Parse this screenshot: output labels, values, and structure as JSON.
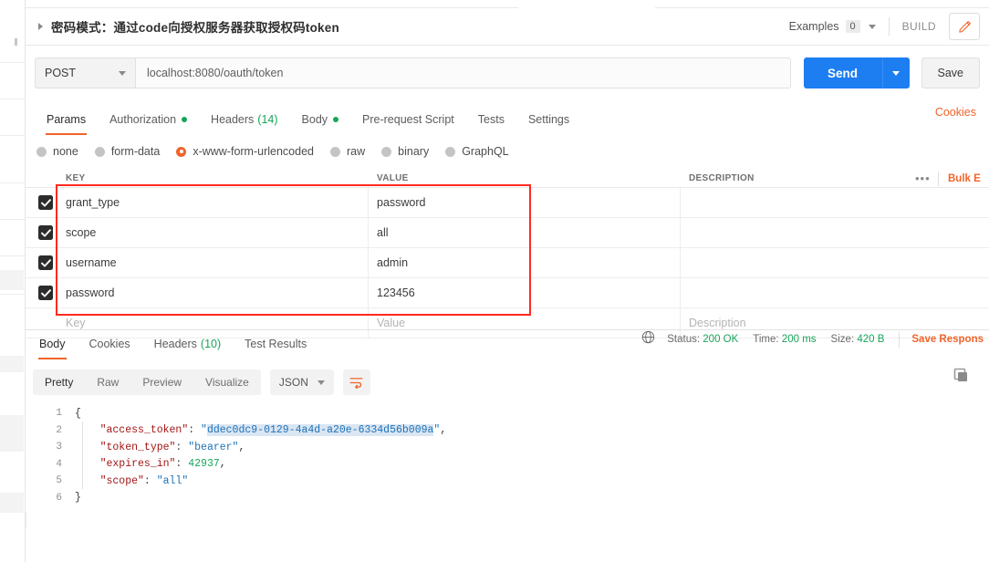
{
  "request": {
    "title": "密码模式：通过code向授权服务器获取授权码token",
    "expand_icon": "caret-right-icon",
    "examples_label": "Examples",
    "examples_count": "0",
    "build_label": "BUILD",
    "edit_icon": "pencil-icon",
    "method": "POST",
    "url": "localhost:8080/oauth/token",
    "send_label": "Send",
    "save_label": "Save",
    "cookies_label": "Cookies"
  },
  "request_tabs": [
    {
      "label": "Params",
      "active": false,
      "dot": false,
      "count": ""
    },
    {
      "label": "Authorization",
      "active": false,
      "dot": true,
      "count": ""
    },
    {
      "label": "Headers",
      "active": false,
      "dot": false,
      "count": "(14)"
    },
    {
      "label": "Body",
      "active": true,
      "dot": true,
      "count": ""
    },
    {
      "label": "Pre-request Script",
      "active": false,
      "dot": false,
      "count": ""
    },
    {
      "label": "Tests",
      "active": false,
      "dot": false,
      "count": ""
    },
    {
      "label": "Settings",
      "active": false,
      "dot": false,
      "count": ""
    }
  ],
  "body_types": [
    {
      "label": "none",
      "selected": false
    },
    {
      "label": "form-data",
      "selected": false
    },
    {
      "label": "x-www-form-urlencoded",
      "selected": true
    },
    {
      "label": "raw",
      "selected": false
    },
    {
      "label": "binary",
      "selected": false
    },
    {
      "label": "GraphQL",
      "selected": false
    }
  ],
  "kv_table": {
    "headers": {
      "key": "KEY",
      "value": "VALUE",
      "description": "DESCRIPTION"
    },
    "more_icon": "•••",
    "bulk_edit_label": "Bulk E",
    "rows": [
      {
        "checked": true,
        "key": "grant_type",
        "value": "password",
        "description": ""
      },
      {
        "checked": true,
        "key": "scope",
        "value": "all",
        "description": ""
      },
      {
        "checked": true,
        "key": "username",
        "value": "admin",
        "description": ""
      },
      {
        "checked": true,
        "key": "password",
        "value": "123456",
        "description": ""
      }
    ],
    "placeholder": {
      "key": "Key",
      "value": "Value",
      "description": "Description"
    }
  },
  "annotation": {
    "color": "#ff2a1f"
  },
  "response_tabs": [
    {
      "label": "Body",
      "active": true,
      "count": ""
    },
    {
      "label": "Cookies",
      "active": false,
      "count": ""
    },
    {
      "label": "Headers",
      "active": false,
      "count": "(10)"
    },
    {
      "label": "Test Results",
      "active": false,
      "count": ""
    }
  ],
  "response_meta": {
    "globe_icon": "globe-icon",
    "status_label": "Status:",
    "status_value": "200 OK",
    "time_label": "Time:",
    "time_value": "200 ms",
    "size_label": "Size:",
    "size_value": "420 B",
    "save_response_label": "Save Respons"
  },
  "response_toolbar": {
    "segments": [
      {
        "label": "Pretty",
        "active": true
      },
      {
        "label": "Raw",
        "active": false
      },
      {
        "label": "Preview",
        "active": false
      },
      {
        "label": "Visualize",
        "active": false
      }
    ],
    "format": "JSON",
    "wrap_icon": "word-wrap-icon",
    "copy_icon": "copy-icon"
  },
  "response_body": {
    "lines": [
      {
        "n": "1",
        "segments": [
          {
            "t": "{",
            "c": "punc"
          }
        ]
      },
      {
        "n": "2",
        "segments": [
          {
            "t": "    \"access_token\"",
            "c": "key"
          },
          {
            "t": ": ",
            "c": "punc"
          },
          {
            "t": "\"",
            "c": "str"
          },
          {
            "t": "ddec0dc9-0129-4a4d-a20e-6334d56b009a",
            "c": "str-sel"
          },
          {
            "t": "\"",
            "c": "str"
          },
          {
            "t": ",",
            "c": "punc"
          }
        ]
      },
      {
        "n": "3",
        "segments": [
          {
            "t": "    \"token_type\"",
            "c": "key"
          },
          {
            "t": ": ",
            "c": "punc"
          },
          {
            "t": "\"bearer\"",
            "c": "str"
          },
          {
            "t": ",",
            "c": "punc"
          }
        ]
      },
      {
        "n": "4",
        "segments": [
          {
            "t": "    \"expires_in\"",
            "c": "key"
          },
          {
            "t": ": ",
            "c": "punc"
          },
          {
            "t": "42937",
            "c": "num"
          },
          {
            "t": ",",
            "c": "punc"
          }
        ]
      },
      {
        "n": "5",
        "segments": [
          {
            "t": "    \"scope\"",
            "c": "key"
          },
          {
            "t": ": ",
            "c": "punc"
          },
          {
            "t": "\"all\"",
            "c": "str"
          }
        ]
      },
      {
        "n": "6",
        "segments": [
          {
            "t": "}",
            "c": "punc"
          }
        ]
      }
    ]
  }
}
